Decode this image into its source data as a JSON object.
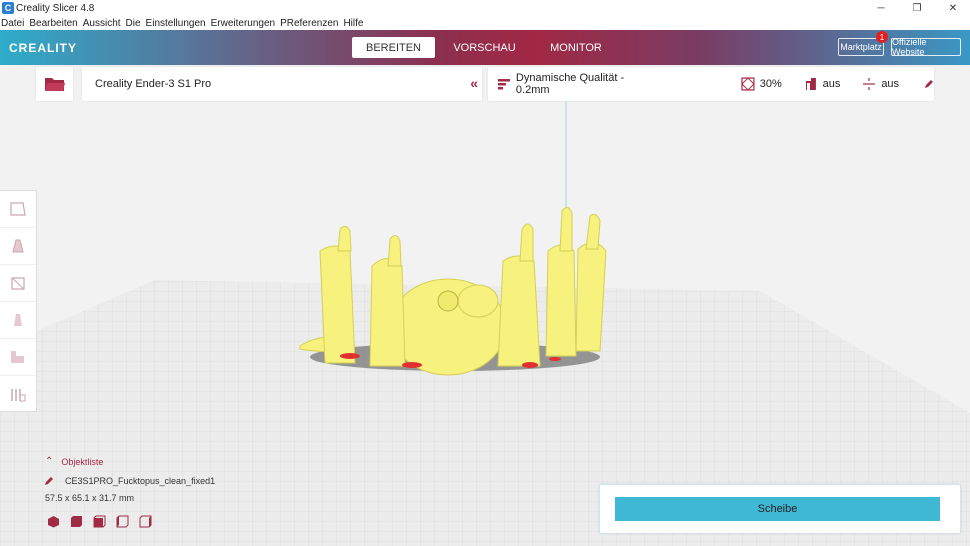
{
  "window": {
    "title": "Creality Slicer 4.8",
    "icon": "C"
  },
  "menu": [
    "Datei",
    "Bearbeiten",
    "Aussicht",
    "Die",
    "Einstellungen",
    "Erweiterungen",
    "PReferenzen",
    "Hilfe"
  ],
  "header": {
    "logo": "CREALITY",
    "tabs": [
      {
        "label": "BEREITEN",
        "active": true
      },
      {
        "label": "VORSCHAU",
        "active": false
      },
      {
        "label": "MONITOR",
        "active": false
      }
    ],
    "marketplace_label": "Marktplatz",
    "marketplace_badge": "1",
    "website_label": "Offizielle Website"
  },
  "printer": {
    "name": "Creality Ender-3 S1 Pro"
  },
  "profile": {
    "quality": "Dynamische Qualität - 0.2mm",
    "infill": "30%",
    "support": "aus",
    "adhesion": "aus"
  },
  "object_list": {
    "title": "Objektliste",
    "file_name": "CE3S1PRO_Fucktopus_clean_fixed1",
    "dimensions": "57.5 x 65.1 x 31.7 mm"
  },
  "slice": {
    "label": "Scheibe"
  },
  "colors": {
    "accent": "#a12a44",
    "slice_button": "#3fb8d3",
    "model": "#f7f17e"
  },
  "icons": [
    "folder-icon",
    "infill-icon",
    "support-icon",
    "adhesion-icon",
    "edit-icon",
    "move-icon",
    "scale-icon",
    "rotate-icon",
    "mirror-icon",
    "per-model-settings-icon",
    "support-blocker-icon"
  ]
}
